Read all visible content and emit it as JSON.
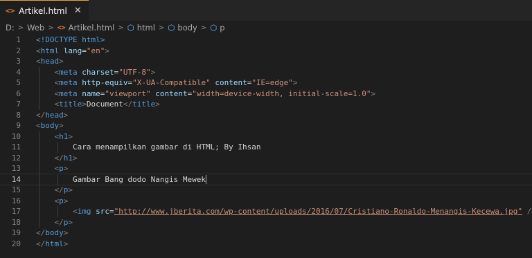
{
  "tab": {
    "title": "Artikel.html",
    "icon": "html-file-icon",
    "close": "✕"
  },
  "breadcrumb": {
    "drive": "D:",
    "folder": "Web",
    "file": "Artikel.html",
    "items": [
      "html",
      "body",
      "p"
    ]
  },
  "code": {
    "current_line": 14,
    "line_numbers": [
      "1",
      "2",
      "3",
      "4",
      "5",
      "6",
      "7",
      "8",
      "9",
      "10",
      "11",
      "12",
      "13",
      "14",
      "15",
      "16",
      "17",
      "18",
      "19",
      "20"
    ],
    "doctype": "<!DOCTYPE html>",
    "html_open_tag": "html",
    "lang_attr": "lang",
    "lang_val": "\"en\"",
    "head_tag": "head",
    "meta_tag": "meta",
    "charset_attr": "charset",
    "charset_val": "\"UTF-8\"",
    "http_equiv_attr": "http-equiv",
    "http_equiv_val": "\"X-UA-Compatible\"",
    "content_attr": "content",
    "content_val_ie": "\"IE=edge\"",
    "name_attr": "name",
    "name_val": "\"viewport\"",
    "content_val_viewport": "\"width=device-width, initial-scale=1.0\"",
    "title_tag": "title",
    "title_text": "Document",
    "body_tag": "body",
    "h1_tag": "h1",
    "h1_text": "Cara menampilkan gambar di HTML; By Ihsan",
    "p_tag": "p",
    "p_text": "Gambar Bang dodo Nangis Mewek",
    "img_tag": "img",
    "src_attr": "src",
    "src_val": "\"http://www.jberita.com/wp-content/uploads/2016/07/Cristiano-Ronaldo-Menangis-Kecewa.jpg\""
  }
}
